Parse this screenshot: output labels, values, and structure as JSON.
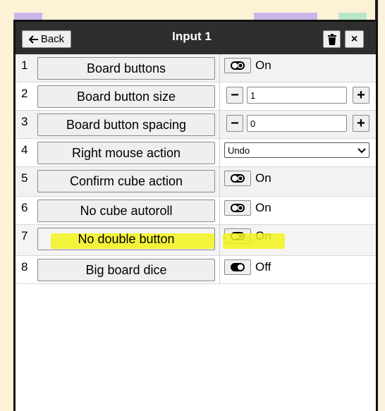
{
  "colors": {
    "background": "#fdf1d6",
    "header": "#2e2e2e",
    "highlight": "#f3f21a"
  },
  "header": {
    "back_label": "Back",
    "back_icon": "arrow-left-icon",
    "title": "Input 1",
    "trash_icon": "trash-icon",
    "close_label": "×"
  },
  "rows": [
    {
      "num": "1",
      "label": "Board buttons",
      "control": "toggle",
      "toggle_state": "on",
      "value": "On"
    },
    {
      "num": "2",
      "label": "Board button size",
      "control": "stepper",
      "value": "1",
      "minus": "−",
      "plus": "+"
    },
    {
      "num": "3",
      "label": "Board button spacing",
      "control": "stepper",
      "value": "0",
      "minus": "−",
      "plus": "+"
    },
    {
      "num": "4",
      "label": "Right mouse action",
      "control": "select",
      "value": "Undo"
    },
    {
      "num": "5",
      "label": "Confirm cube action",
      "control": "toggle",
      "toggle_state": "on",
      "value": "On"
    },
    {
      "num": "6",
      "label": "No cube autoroll",
      "control": "toggle",
      "toggle_state": "on",
      "value": "On"
    },
    {
      "num": "7",
      "label": "No double button",
      "control": "toggle",
      "toggle_state": "on",
      "value": "On",
      "highlighted": true
    },
    {
      "num": "8",
      "label": "Big board dice",
      "control": "toggle",
      "toggle_state": "off",
      "value": "Off"
    }
  ]
}
